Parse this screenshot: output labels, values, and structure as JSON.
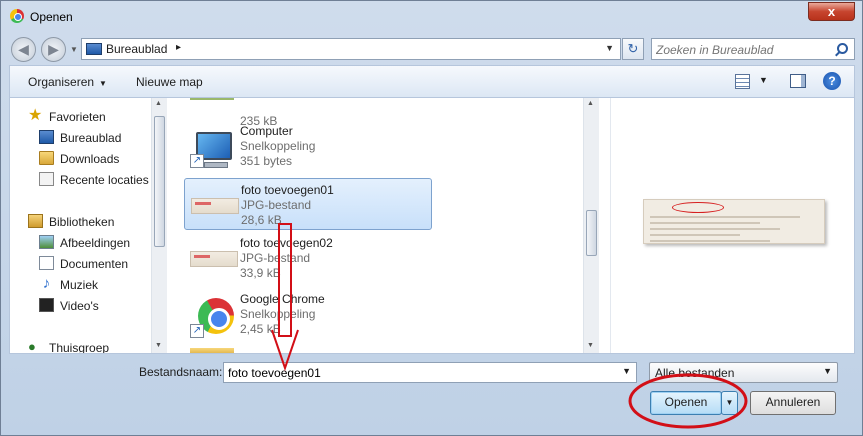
{
  "window": {
    "title": "Openen",
    "close_label": "x"
  },
  "address": {
    "location": "Bureaublad",
    "separator": "▸",
    "search_placeholder": "Zoeken in Bureaublad"
  },
  "toolbar": {
    "organise_label": "Organiseren",
    "new_folder_label": "Nieuwe map"
  },
  "nav": {
    "favorites": "Favorieten",
    "favorite_items": [
      "Bureaublad",
      "Downloads",
      "Recente locaties"
    ],
    "libraries": "Bibliotheken",
    "library_items": [
      "Afbeeldingen",
      "Documenten",
      "Muziek",
      "Video's"
    ],
    "homegroup": "Thuisgroep"
  },
  "files": [
    {
      "name": "",
      "type": "",
      "size": "235 kB"
    },
    {
      "name": "Computer",
      "type": "Snelkoppeling",
      "size": "351 bytes"
    },
    {
      "name": "foto toevoegen01",
      "type": "JPG-bestand",
      "size": "28,6 kB",
      "selected": true
    },
    {
      "name": "foto toevoegen02",
      "type": "JPG-bestand",
      "size": "33,9 kB"
    },
    {
      "name": "Google Chrome",
      "type": "Snelkoppeling",
      "size": "2,45 kB"
    }
  ],
  "footer": {
    "filename_label": "Bestandsnaam:",
    "filename_value": "foto toevoegen01",
    "filter_value": "Alle bestanden",
    "open_label": "Openen",
    "cancel_label": "Annuleren"
  },
  "colors": {
    "annotation_red": "#d20f17",
    "selection_blue": "#c8e0fa"
  }
}
